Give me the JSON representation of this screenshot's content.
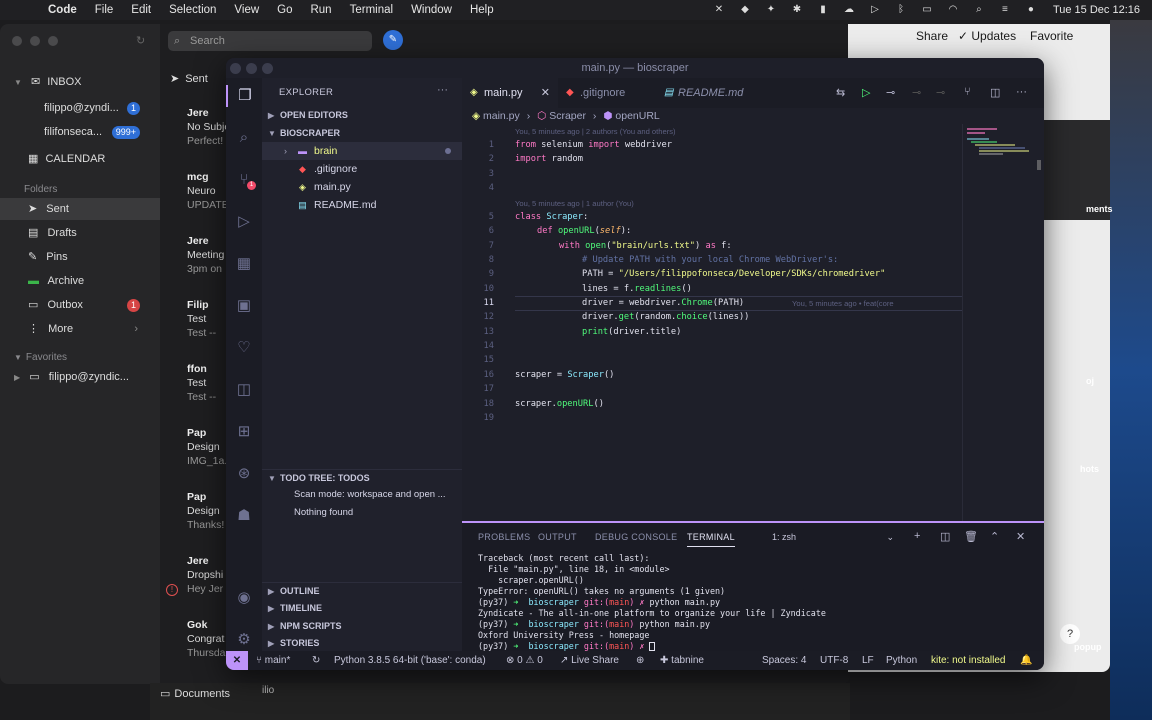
{
  "menubar": {
    "app": "Code",
    "items": [
      "File",
      "Edit",
      "Selection",
      "View",
      "Go",
      "Run",
      "Terminal",
      "Window",
      "Help"
    ],
    "clock": "Tue 15 Dec  12:16"
  },
  "mail": {
    "search_placeholder": "Search",
    "sent_header": "Sent",
    "inbox_label": "INBOX",
    "accounts": [
      {
        "label": "filippo@zyndi...",
        "badge": "1"
      },
      {
        "label": "filifonseca...",
        "badge": "999+"
      }
    ],
    "calendar_label": "CALENDAR",
    "folders_header": "Folders",
    "folders": [
      {
        "label": "Sent"
      },
      {
        "label": "Drafts"
      },
      {
        "label": "Pins"
      },
      {
        "label": "Archive"
      },
      {
        "label": "Outbox",
        "badge": "1"
      },
      {
        "label": "More"
      }
    ],
    "favorites_header": "Favorites",
    "favorite_account": "filippo@zyndic...",
    "messages": [
      {
        "from": "Jere",
        "subject": "No Subje",
        "preview": "Perfect!"
      },
      {
        "from": "mcg",
        "subject": "Neuro",
        "preview": "UPDATE"
      },
      {
        "from": "Jere",
        "subject": "Meeting",
        "preview": "3pm on"
      },
      {
        "from": "Filip",
        "subject": "Test",
        "preview": "Test --"
      },
      {
        "from": "ffon",
        "subject": "Test",
        "preview": "Test --"
      },
      {
        "from": "Pap",
        "subject": "Design",
        "preview": "IMG_1a."
      },
      {
        "from": "Pap",
        "subject": "Design",
        "preview": "Thanks!"
      },
      {
        "from": "Jere",
        "subject": "Dropshi",
        "preview": "Hey Jer"
      },
      {
        "from": "Gok",
        "subject": "Congrat",
        "preview": "Thursda"
      }
    ],
    "bottom_folder": "Documents",
    "bottom_user": "ilio"
  },
  "notes": {
    "share": "Share",
    "updates": "Updates",
    "favorite": "Favorite",
    "side_labels": [
      "ments",
      "oj",
      "hots",
      "popup"
    ]
  },
  "vscode": {
    "title": "main.py — bioscraper",
    "explorer_title": "EXPLORER",
    "open_editors": "OPEN EDITORS",
    "project": "BIOSCRAPER",
    "files": [
      {
        "name": "brain",
        "type": "folder"
      },
      {
        "name": ".gitignore",
        "type": "git"
      },
      {
        "name": "main.py",
        "type": "py"
      },
      {
        "name": "README.md",
        "type": "md"
      }
    ],
    "todo_section": "TODO TREE: TODOS",
    "todo_scan": "Scan mode: workspace and open ...",
    "todo_empty": "Nothing found",
    "outline": "OUTLINE",
    "timeline": "TIMELINE",
    "npm": "NPM SCRIPTS",
    "stories": "STORIES",
    "tabs": [
      "main.py",
      ".gitignore",
      "README.md"
    ],
    "breadcrumb": [
      "main.py",
      "Scraper",
      "openURL"
    ],
    "blame1": "You, 5 minutes ago | 2 authors (You and others)",
    "blame2": "You, 5 minutes ago | 1 author (You)",
    "inline_blame": "You, 5 minutes ago • feat(core",
    "line_numbers": [
      "1",
      "2",
      "3",
      "4",
      "5",
      "6",
      "7",
      "8",
      "9",
      "10",
      "11",
      "12",
      "13",
      "14",
      "15",
      "16",
      "17",
      "18",
      "19"
    ],
    "code": {
      "l1": [
        "from",
        " selenium ",
        "import",
        " webdriver"
      ],
      "l2": [
        "import",
        " random"
      ],
      "l5": [
        "class",
        " ",
        "Scraper",
        ":"
      ],
      "l6": [
        "def",
        " ",
        "openURL",
        "(",
        "self",
        "):"
      ],
      "l7": [
        "with",
        " ",
        "open",
        "(",
        "\"brain/urls.txt\"",
        ") ",
        "as",
        " f:"
      ],
      "l8": "# Update PATH with your local Chrome WebDriver's:",
      "l9": [
        "PATH = ",
        "\"/Users/filippofonseca/Developer/SDKs/chromedriver\""
      ],
      "l10": [
        "lines = f.",
        "readlines",
        "()"
      ],
      "l11": [
        "driver = webdriver.",
        "Chrome",
        "(PATH)"
      ],
      "l12": [
        "driver.",
        "get",
        "(random.",
        "choice",
        "(lines))"
      ],
      "l13": [
        "print",
        "(driver.title)"
      ],
      "l16": [
        "scraper = ",
        "Scraper",
        "()"
      ],
      "l18": [
        "scraper.",
        "openURL",
        "()"
      ]
    },
    "panel_tabs": [
      "PROBLEMS",
      "OUTPUT",
      "DEBUG CONSOLE",
      "TERMINAL"
    ],
    "terminal_select": "1: zsh",
    "terminal": {
      "t1": "Traceback (most recent call last):",
      "t2": "  File \"main.py\", line 18, in <module>",
      "t3": "    scraper.openURL()",
      "t4": "TypeError: openURL() takes no arguments (1 given)",
      "t5": [
        "(py37) ",
        "➜  ",
        "bioscraper ",
        "git:(",
        "main",
        ") ✗ ",
        "python main.py"
      ],
      "t6": "Zyndicate - The all-in-one platform to organize your life | Zyndicate",
      "t7": [
        "(py37) ",
        "➜  ",
        "bioscraper ",
        "git:(",
        "main",
        ") ",
        "python main.py"
      ],
      "t8": "Oxford University Press - homepage",
      "t9": [
        "(py37) ",
        "➜  ",
        "bioscraper ",
        "git:(",
        "main",
        ") ✗ "
      ]
    },
    "status": {
      "branch": "main*",
      "python": "Python 3.8.5 64-bit ('base': conda)",
      "errors": "⊗ 0 ⚠ 0",
      "liveshare": "Live Share",
      "tabnine": "tabnine",
      "spaces": "Spaces: 4",
      "encoding": "UTF-8",
      "eol": "LF",
      "lang": "Python",
      "kite": "kite: not installed"
    }
  }
}
